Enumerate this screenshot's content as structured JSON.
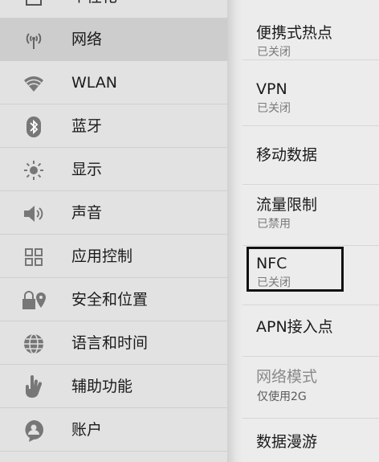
{
  "sidebar": {
    "partial_top_label": "个性化",
    "items": [
      {
        "label": "网络",
        "icon": "network-icon",
        "selected": true
      },
      {
        "label": "WLAN",
        "icon": "wifi-icon"
      },
      {
        "label": "蓝牙",
        "icon": "bluetooth-icon"
      },
      {
        "label": "显示",
        "icon": "brightness-icon"
      },
      {
        "label": "声音",
        "icon": "speaker-icon"
      },
      {
        "label": "应用控制",
        "icon": "apps-grid-icon"
      },
      {
        "label": "安全和位置",
        "icon": "lock-location-icon"
      },
      {
        "label": "语言和时间",
        "icon": "globe-icon"
      },
      {
        "label": "辅助功能",
        "icon": "hand-icon"
      },
      {
        "label": "账户",
        "icon": "account-icon"
      }
    ]
  },
  "panel": {
    "items": [
      {
        "title": "便携式热点",
        "subtitle": "已关闭"
      },
      {
        "title": "VPN",
        "subtitle": "已关闭"
      },
      {
        "title": "移动数据"
      },
      {
        "title": "流量限制",
        "subtitle": "已禁用"
      },
      {
        "title": "NFC",
        "subtitle": "已关闭",
        "highlighted": true
      },
      {
        "title": "APN接入点"
      },
      {
        "title": "网络模式",
        "subtitle": "仅使用2G",
        "disabled": true
      },
      {
        "title": "数据漫游"
      }
    ]
  }
}
